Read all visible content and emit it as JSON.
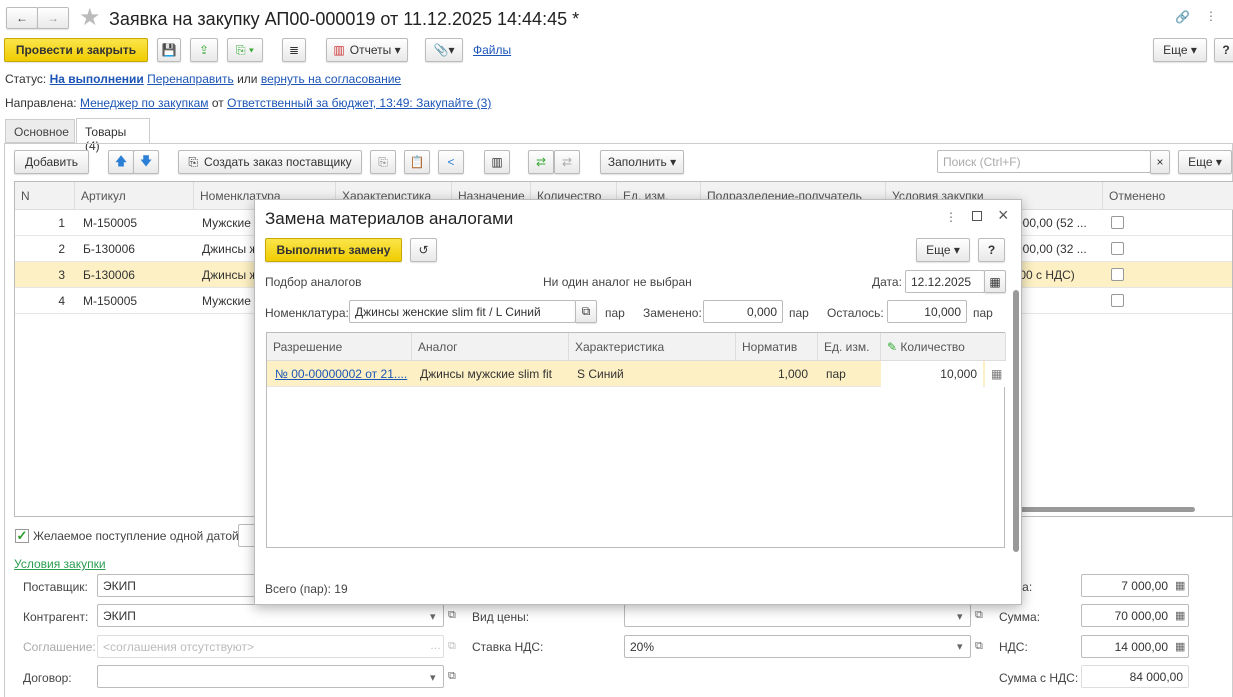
{
  "window": {
    "title": "Заявка на закупку АП00-000019 от 11.12.2025 14:44:45 *"
  },
  "toolbar": {
    "post_close": "Провести и закрыть",
    "reports": "Отчеты",
    "files": "Файлы",
    "more": "Еще",
    "help": "?"
  },
  "status": {
    "label": "Статус:",
    "value": "На выполнении",
    "redirect": "Перенаправить",
    "or": "или",
    "return": "вернуть на согласование"
  },
  "directed": {
    "label": "Направлена:",
    "to": "Менеджер по закупкам",
    "from_word": "от",
    "from": "Ответственный за бюджет, 13:49: Закупайте (3)"
  },
  "tabs": [
    {
      "label": "Основное"
    },
    {
      "label": "Товары (4)"
    }
  ],
  "goods_toolbar": {
    "add": "Добавить",
    "create_order": "Создать заказ поставщику",
    "fill": "Заполнить",
    "search_placeholder": "Поиск (Ctrl+F)",
    "more": "Еще"
  },
  "table": {
    "columns": [
      "N",
      "Артикул",
      "Номенклатура",
      "Характеристика",
      "Назначение",
      "Количество",
      "Ед. изм.",
      "Подразделение-получатель",
      "Условия закупки",
      "Отменено"
    ],
    "rows": [
      {
        "n": "1",
        "art": "М-150005",
        "nom": "Мужские",
        "cond": "000,00 (52 ..."
      },
      {
        "n": "2",
        "art": "Б-130006",
        "nom": "Джинсы ж",
        "cond": "000,00 (32 ..."
      },
      {
        "n": "3",
        "art": "Б-130006",
        "nom": "Джинсы ж",
        "cond": ",00 с НДС)"
      },
      {
        "n": "4",
        "art": "М-150005",
        "nom": "Мужские",
        "cond": ""
      }
    ]
  },
  "desired_date": {
    "label": "Желаемое поступление одной датой",
    "checked": true
  },
  "conditions": {
    "title": "Условия закупки",
    "supplier_label": "Поставщик:",
    "supplier": "ЭКИП",
    "counterparty_label": "Контрагент:",
    "counterparty": "ЭКИП",
    "agreement_label": "Соглашение:",
    "agreement_placeholder": "<соглашения отсутствуют>",
    "contract_label": "Договор:",
    "contract": "",
    "price_type_label": "Вид цены:",
    "price_type": "",
    "vat_rate_label": "Ставка НДС:",
    "vat_rate": "20%",
    "price_label": "Цена:",
    "price": "7 000,00",
    "sum_label": "Сумма:",
    "sum": "70 000,00",
    "vat_label": "НДС:",
    "vat": "14 000,00",
    "total_label": "Сумма с НДС:",
    "total": "84 000,00"
  },
  "dialog": {
    "title": "Замена материалов аналогами",
    "execute": "Выполнить замену",
    "more": "Еще",
    "help": "?",
    "selection": "Подбор аналогов",
    "no_analog": "Ни один аналог не выбран",
    "date_label": "Дата:",
    "date": "12.12.2025",
    "nom_label": "Номенклатура:",
    "nom": "Джинсы женские slim fit / L Синий",
    "unit": "пар",
    "replaced_label": "Заменено:",
    "replaced": "0,000",
    "left_label": "Осталось:",
    "left": "10,000",
    "columns": [
      "Разрешение",
      "Аналог",
      "Характеристика",
      "Норматив",
      "Ед. изм.",
      "Количество"
    ],
    "rows": [
      {
        "permit": "№ 00-00000002 от 21....",
        "analog": "Джинсы мужские slim fit",
        "char": "S Синий",
        "norm": "1,000",
        "unit": "пар",
        "qty": "10,000"
      }
    ],
    "total": "Всего (пар): 19"
  }
}
